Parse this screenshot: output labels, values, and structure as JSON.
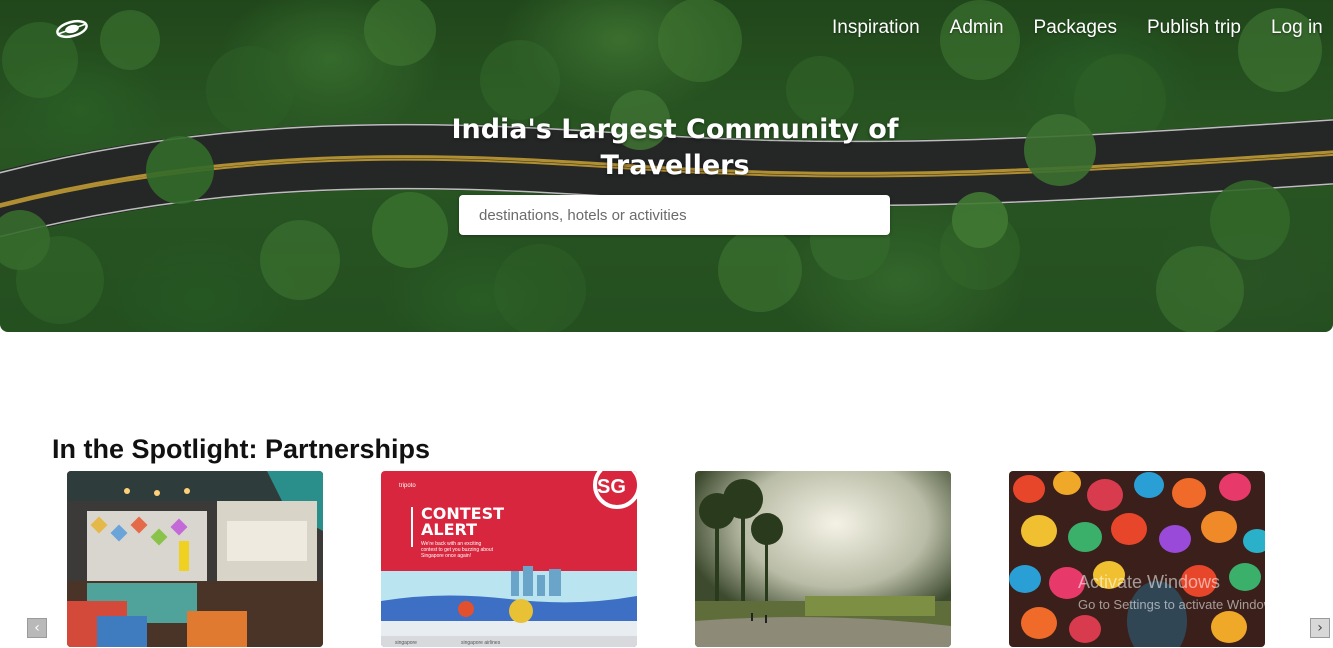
{
  "nav": {
    "items": [
      "Inspiration",
      "Admin",
      "Packages",
      "Publish trip",
      "Log in"
    ]
  },
  "hero": {
    "title": "India's Largest Community of Travellers",
    "search_placeholder": "destinations, hotels or activities"
  },
  "spotlight": {
    "title": "In the Spotlight: Partnerships",
    "cards": [
      {
        "name": "lounge-room"
      },
      {
        "name": "contest-alert",
        "brand": "tripoto",
        "headline": "CONTEST ALERT",
        "body": "We're back with an exciting contest to get you buzzing about Singapore once again!",
        "badge": "SG"
      },
      {
        "name": "misty-forest"
      },
      {
        "name": "lanterns"
      }
    ]
  },
  "overlay": {
    "line1": "Activate Windows",
    "line2": "Go to Settings to activate Windows."
  },
  "colors": {
    "contest_red": "#d7263d",
    "brand_white": "#ffffff"
  }
}
